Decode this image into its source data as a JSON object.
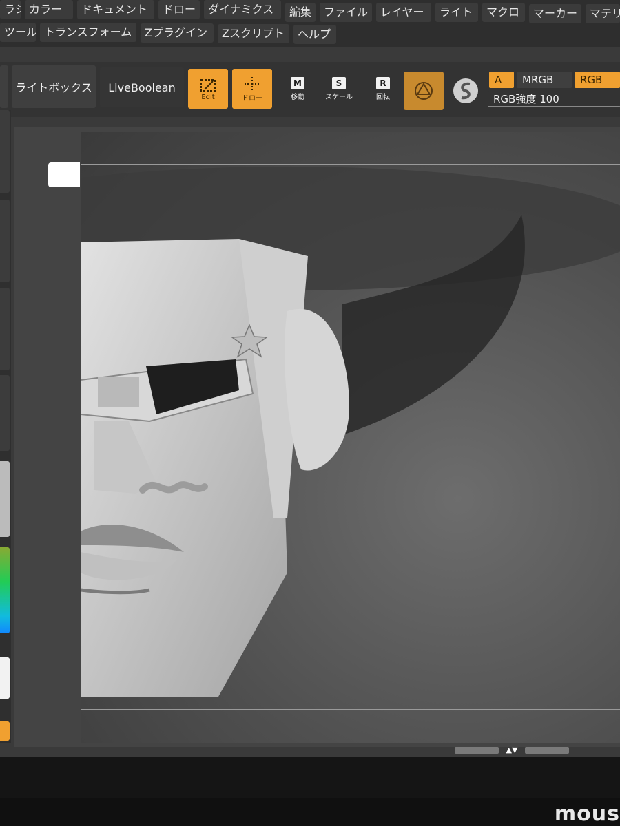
{
  "menu": {
    "row1": [
      "ラシ",
      "カラー",
      "ドキュメント",
      "ドロー",
      "ダイナミクス",
      "編集",
      "ファイル",
      "レイヤー",
      "ライト",
      "マクロ",
      "マーカー",
      "マテリ"
    ],
    "row2": [
      "ツール",
      "トランスフォーム",
      "Zプラグイン",
      "Zスクリプト",
      "ヘルプ"
    ]
  },
  "toolbar": {
    "lightbox": "ライトボックス",
    "liveboolean": "LiveBoolean",
    "edit_label": "Edit",
    "draw_label": "ドロー",
    "move_key": "M",
    "move_label": "移動",
    "scale_key": "S",
    "scale_label": "スケール",
    "rotate_key": "R",
    "rotate_label": "回転",
    "a_chip": "A",
    "mrgb_chip": "MRGB",
    "rgb_chip": "RGB",
    "rgb_intensity": "RGB強度 100"
  },
  "bezel": {
    "brand": "mous"
  },
  "colors": {
    "accent": "#f0a030",
    "panel": "#3b3b3b",
    "background": "#2e2e2e"
  }
}
